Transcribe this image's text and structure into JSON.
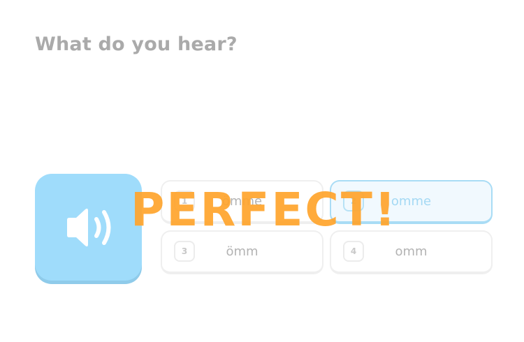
{
  "exercise": {
    "prompt": "What do you hear?"
  },
  "speaker_button": {
    "icon": "speaker-icon",
    "color": "#9fdcfb"
  },
  "options": [
    {
      "number": "1",
      "text": "ömme",
      "selected": false
    },
    {
      "number": "2",
      "text": "omme",
      "selected": true
    },
    {
      "number": "3",
      "text": "ömm",
      "selected": false
    },
    {
      "number": "4",
      "text": "omm",
      "selected": false
    }
  ],
  "feedback": {
    "text": "PERFECT!",
    "color": "#ffa52e"
  },
  "colors": {
    "prompt_text": "#aaaaaa",
    "selected_border": "#a9dcf5",
    "selected_background": "#f1f9fe"
  }
}
